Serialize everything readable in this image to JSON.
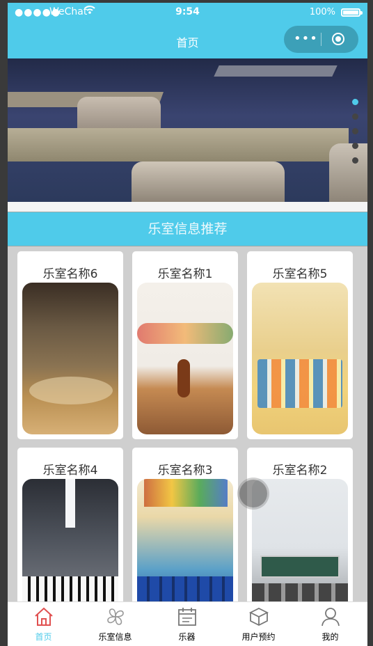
{
  "status_bar": {
    "signal": "●●●●●",
    "carrier": "WeChat",
    "time": "9:54",
    "battery": "100%"
  },
  "nav": {
    "title": "首页",
    "menu_glyph": "•••"
  },
  "banner": {
    "slide_count": 5,
    "active_slide": 1
  },
  "section": {
    "title": "乐室信息推荐"
  },
  "rooms": [
    {
      "name": "乐室名称6"
    },
    {
      "name": "乐室名称1"
    },
    {
      "name": "乐室名称5"
    },
    {
      "name": "乐室名称4"
    },
    {
      "name": "乐室名称3"
    },
    {
      "name": "乐室名称2"
    }
  ],
  "tabbar": {
    "items": [
      {
        "label": "首页",
        "icon": "home-icon",
        "active": true
      },
      {
        "label": "乐室信息",
        "icon": "clover-icon",
        "active": false
      },
      {
        "label": "乐器",
        "icon": "calendar-icon",
        "active": false
      },
      {
        "label": "用户预约",
        "icon": "box-icon",
        "active": false
      },
      {
        "label": "我的",
        "icon": "user-icon",
        "active": false
      }
    ]
  },
  "colors": {
    "accent": "#4fcbea",
    "capsule": "#3ca0b8",
    "home_icon": "#e05050"
  }
}
